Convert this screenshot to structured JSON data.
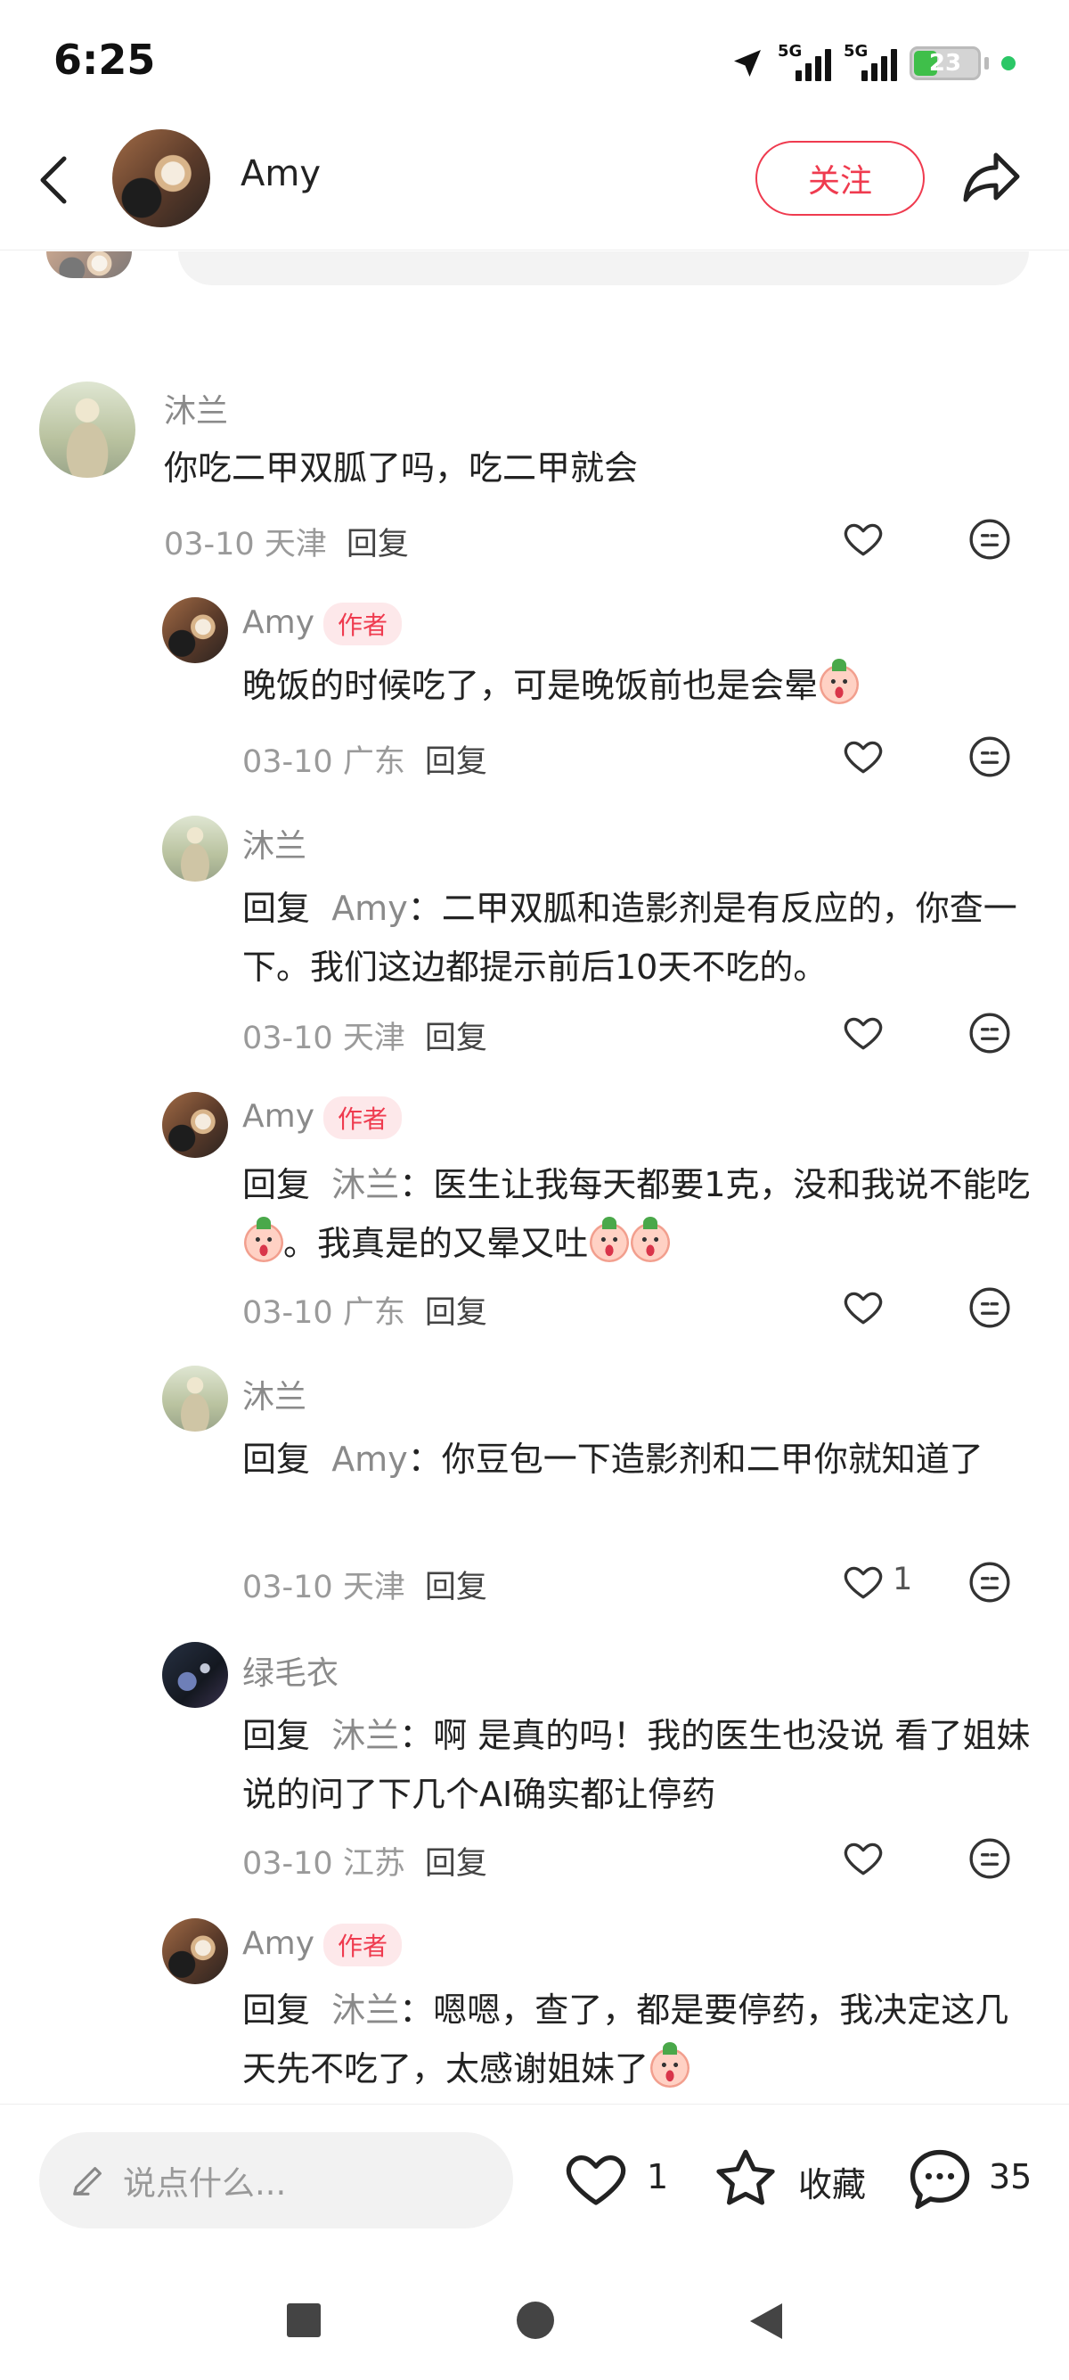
{
  "status_bar": {
    "time": "6:25",
    "network_1": "5G",
    "network_2": "5G",
    "battery": "23"
  },
  "header": {
    "user_name": "Amy",
    "follow_label": "关注",
    "icons": [
      "back-icon",
      "share-icon"
    ]
  },
  "comments": [
    {
      "name": "沐兰",
      "text": "你吃二甲双胍了吗，吃二甲就会",
      "date": "03-10",
      "location": "天津",
      "reply_label": "回复",
      "likes": ""
    },
    {
      "name": "Amy",
      "tag": "作者",
      "text": "晚饭的时候吃了，可是晚饭前也是会晕",
      "date": "03-10",
      "location": "广东",
      "reply_label": "回复",
      "likes": ""
    },
    {
      "name": "沐兰",
      "reply_prefix": "回复",
      "reply_to": "Amy",
      "text": "：二甲双胍和造影剂是有反应的，你查一下。我们这边都提示前后10天不吃的。",
      "date": "03-10",
      "location": "天津",
      "reply_label": "回复",
      "likes": ""
    },
    {
      "name": "Amy",
      "tag": "作者",
      "reply_prefix": "回复",
      "reply_to": "沐兰",
      "text": "：医生让我每天都要1克，没和我说不能吃",
      "text2": "。我真是的又晕又吐",
      "date": "03-10",
      "location": "广东",
      "reply_label": "回复",
      "likes": ""
    },
    {
      "name": "沐兰",
      "reply_prefix": "回复",
      "reply_to": "Amy",
      "text": "：你豆包一下造影剂和二甲你就知道了",
      "date": "03-10",
      "location": "天津",
      "reply_label": "回复",
      "likes": "1"
    },
    {
      "name": "绿毛衣",
      "reply_prefix": "回复",
      "reply_to": "沐兰",
      "text": "：啊 是真的吗！我的医生也没说 看了姐妹说的问了下几个AI确实都让停药",
      "date": "03-10",
      "location": "江苏",
      "reply_label": "回复",
      "likes": ""
    },
    {
      "name": "Amy",
      "tag": "作者",
      "reply_prefix": "回复",
      "reply_to": "沐兰",
      "text": "：嗯嗯，查了，都是要停药，我决定这几天先不吃了，太感谢姐妹了",
      "date": "",
      "location": "",
      "reply_label": "",
      "likes": ""
    }
  ],
  "bottom_bar": {
    "input_placeholder": "说点什么...",
    "like_count": "1",
    "collect_label": "收藏",
    "comment_count": "35"
  }
}
